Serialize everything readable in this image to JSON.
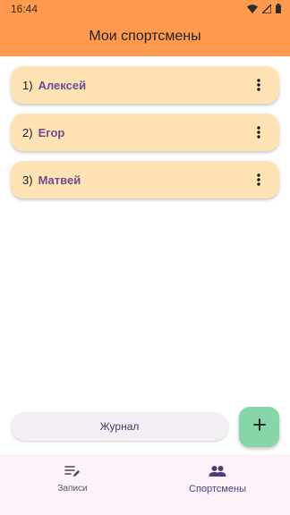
{
  "status_bar": {
    "time": "16:44"
  },
  "app_bar": {
    "title": "Мои спортсмены"
  },
  "athletes": [
    {
      "number": "1)",
      "name": "Алексей"
    },
    {
      "number": "2)",
      "name": "Егор"
    },
    {
      "number": "3)",
      "name": "Матвей"
    }
  ],
  "journal_button": {
    "label": "Журнал"
  },
  "fab": {
    "icon": "plus-icon"
  },
  "bottom_nav": {
    "items": [
      {
        "label": "Записи",
        "icon": "notes-edit-icon",
        "active": false
      },
      {
        "label": "Спортсмены",
        "icon": "group-icon",
        "active": true
      }
    ]
  },
  "colors": {
    "app_bar": "#ff9a4f",
    "card": "#ffe3b5",
    "athlete_name": "#6a4c93",
    "fab": "#86d6a9",
    "bottom_nav": "#fbf2fa"
  }
}
